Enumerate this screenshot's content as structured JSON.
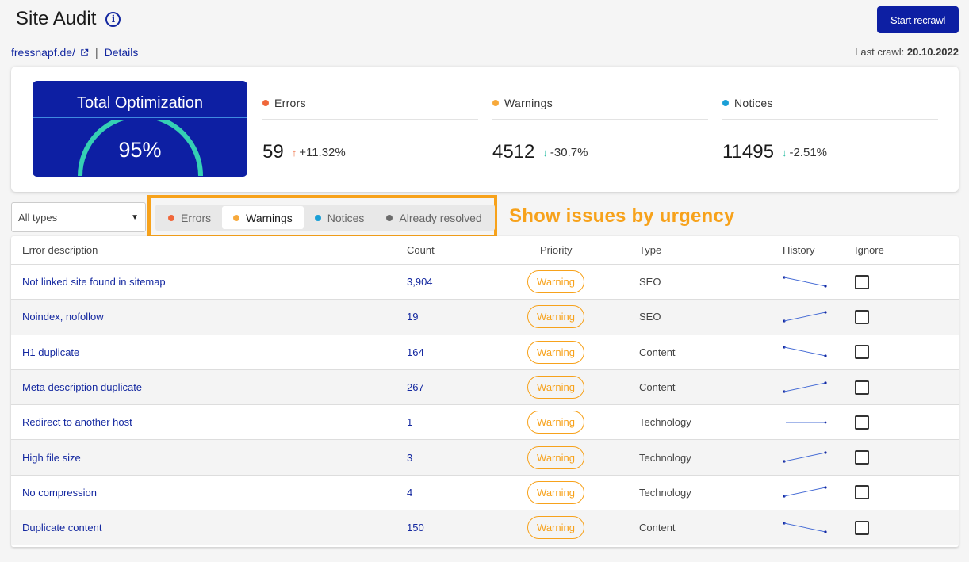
{
  "header": {
    "title": "Site Audit",
    "recrawl_label": "Start recrawl"
  },
  "subheader": {
    "domain": "fressnapf.de/",
    "separator": "|",
    "details": "Details",
    "last_crawl_label": "Last crawl:",
    "last_crawl_date": "20.10.2022"
  },
  "summary": {
    "optimization": {
      "title": "Total Optimization",
      "value": "95%",
      "fraction": 0.95
    },
    "metrics": [
      {
        "label": "Errors",
        "value": "59",
        "delta": "+11.32%",
        "direction": "up",
        "color": "#f0673a",
        "arrow_color": "#f0673a"
      },
      {
        "label": "Warnings",
        "value": "4512",
        "delta": "-30.7%",
        "direction": "down",
        "color": "#f7a93b",
        "arrow_color": "#34c0a8"
      },
      {
        "label": "Notices",
        "value": "11495",
        "delta": "-2.51%",
        "direction": "down",
        "color": "#1a9fd6",
        "arrow_color": "#34c0a8"
      }
    ]
  },
  "filter": {
    "selected": "All types"
  },
  "tabs": [
    {
      "label": "Errors",
      "color": "#f0673a",
      "active": false
    },
    {
      "label": "Warnings",
      "color": "#f7a93b",
      "active": true
    },
    {
      "label": "Notices",
      "color": "#1a9fd6",
      "active": false
    },
    {
      "label": "Already resolved",
      "color": "#6b6b6b",
      "active": false
    }
  ],
  "annotation": "Show issues by urgency",
  "table": {
    "headers": {
      "description": "Error description",
      "count": "Count",
      "priority": "Priority",
      "type": "Type",
      "history": "History",
      "ignore": "Ignore"
    },
    "rows": [
      {
        "description": "Not linked site found in sitemap",
        "count": "3,904",
        "priority": "Warning",
        "type": "SEO",
        "trend": "down"
      },
      {
        "description": "Noindex, nofollow",
        "count": "19",
        "priority": "Warning",
        "type": "SEO",
        "trend": "up"
      },
      {
        "description": "H1 duplicate",
        "count": "164",
        "priority": "Warning",
        "type": "Content",
        "trend": "down"
      },
      {
        "description": "Meta description duplicate",
        "count": "267",
        "priority": "Warning",
        "type": "Content",
        "trend": "up"
      },
      {
        "description": "Redirect to another host",
        "count": "1",
        "priority": "Warning",
        "type": "Technology",
        "trend": "flat"
      },
      {
        "description": "High file size",
        "count": "3",
        "priority": "Warning",
        "type": "Technology",
        "trend": "up"
      },
      {
        "description": "No compression",
        "count": "4",
        "priority": "Warning",
        "type": "Technology",
        "trend": "up"
      },
      {
        "description": "Duplicate content",
        "count": "150",
        "priority": "Warning",
        "type": "Content",
        "trend": "down"
      }
    ]
  },
  "colors": {
    "brand": "#0d1fa3",
    "link": "#1428a0",
    "highlight": "#f7a21b",
    "gauge": "#35d0b4"
  }
}
